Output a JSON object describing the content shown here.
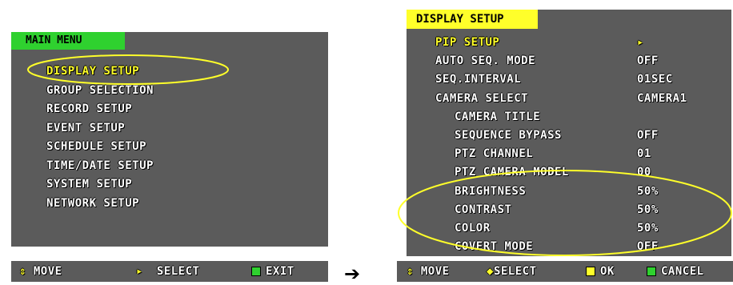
{
  "left_panel": {
    "title": "MAIN MENU",
    "items": [
      {
        "label": "DISPLAY SETUP"
      },
      {
        "label": "GROUP SELECTION"
      },
      {
        "label": "RECORD SETUP"
      },
      {
        "label": "EVENT SETUP"
      },
      {
        "label": "SCHEDULE SETUP"
      },
      {
        "label": "TIME/DATE SETUP"
      },
      {
        "label": "SYSTEM SETUP"
      },
      {
        "label": "NETWORK SETUP"
      }
    ],
    "footer": {
      "move_label": "MOVE",
      "select_label": "SELECT",
      "exit_label": "EXIT"
    }
  },
  "right_panel": {
    "title": "DISPLAY SETUP",
    "items": [
      {
        "label": "PIP SETUP",
        "value": "▸"
      },
      {
        "label": "AUTO SEQ. MODE",
        "value": "OFF"
      },
      {
        "label": "SEQ.INTERVAL",
        "value": "01SEC"
      },
      {
        "label": "CAMERA SELECT",
        "value": "CAMERA1"
      },
      {
        "label": "CAMERA TITLE",
        "value": ""
      },
      {
        "label": "SEQUENCE BYPASS",
        "value": "OFF"
      },
      {
        "label": "PTZ CHANNEL",
        "value": "01"
      },
      {
        "label": "PTZ CAMERA MODEL",
        "value": "00"
      },
      {
        "label": "BRIGHTNESS",
        "value": "50%"
      },
      {
        "label": "CONTRAST",
        "value": "50%"
      },
      {
        "label": "COLOR",
        "value": "50%"
      },
      {
        "label": "COVERT MODE",
        "value": "OFF"
      }
    ],
    "footer": {
      "move_label": "MOVE",
      "select_label": "SELECT",
      "ok_label": "OK",
      "cancel_label": "CANCEL"
    }
  },
  "transition_arrow": "➔",
  "icons": {
    "updown": "⇕",
    "right_triangle": "▸",
    "leftright": "◆"
  },
  "colors": {
    "menu_bg": "#5b5b5b",
    "main_tab": "#2fd12f",
    "display_tab": "#ffff2a",
    "highlight": "#ffff2a",
    "annotation": "#ffff2a"
  }
}
